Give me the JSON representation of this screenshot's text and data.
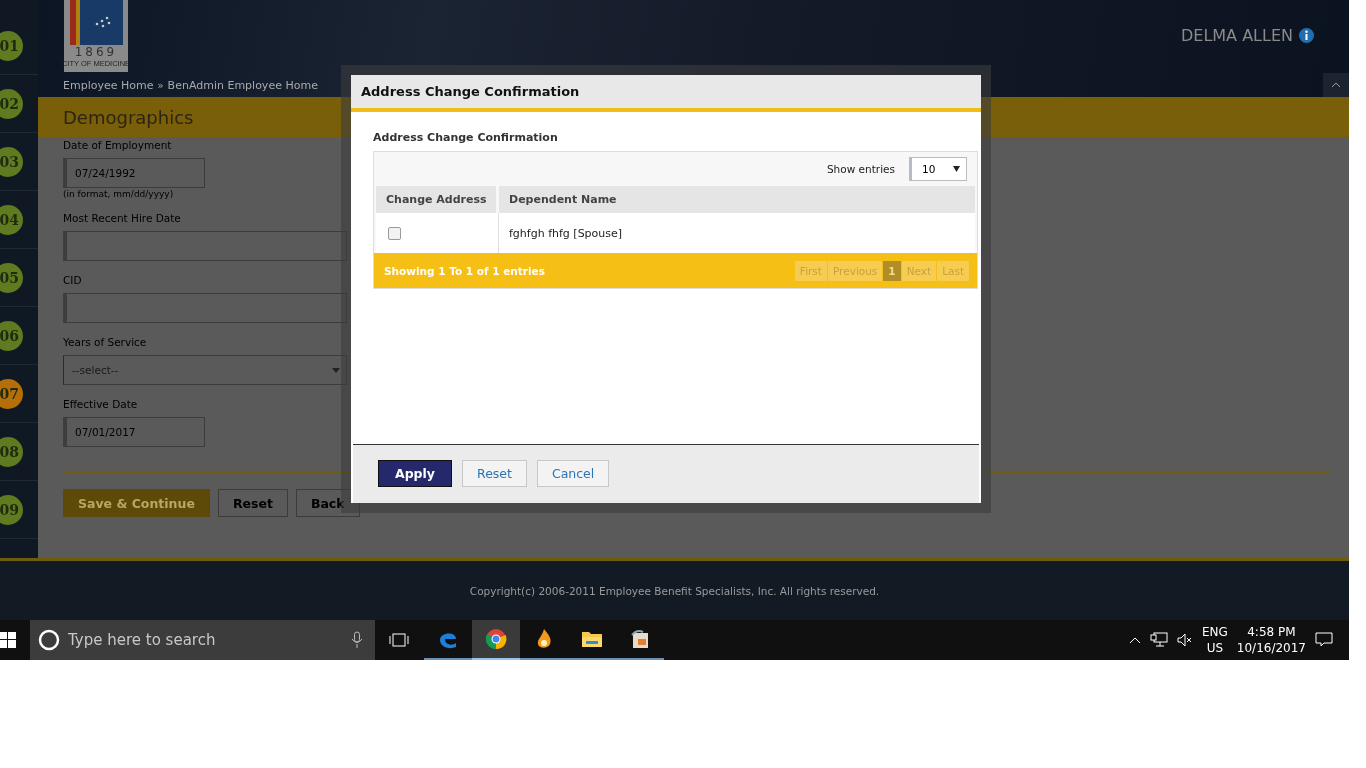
{
  "header": {
    "logo_year": "1869",
    "logo_caption": "CITY OF MEDICINE",
    "user_name": "DELMA ALLEN"
  },
  "breadcrumb": [
    {
      "label": "Employee Home"
    },
    {
      "label": "BenAdmin Employee Home"
    }
  ],
  "breadcrumb_separator": "»",
  "steps": [
    {
      "label": "01",
      "selected": false
    },
    {
      "label": "02",
      "selected": false
    },
    {
      "label": "03",
      "selected": false
    },
    {
      "label": "04",
      "selected": false
    },
    {
      "label": "05",
      "selected": false
    },
    {
      "label": "06",
      "selected": false
    },
    {
      "label": "07",
      "selected": true
    },
    {
      "label": "08",
      "selected": false
    },
    {
      "label": "09",
      "selected": false
    }
  ],
  "page_title": "Demographics",
  "form": [
    {
      "kind": "date",
      "label": "Date of Employment",
      "value": "07/24/1992",
      "hint": "(in format, mm/dd/yyyy)"
    },
    {
      "kind": "text",
      "label": "Most Recent Hire Date"
    },
    {
      "kind": "text",
      "label": "CID"
    },
    {
      "kind": "select",
      "label": "Years of Service",
      "placeholder": "--select--"
    },
    {
      "kind": "date",
      "label": "Effective Date",
      "value": "07/01/2017"
    }
  ],
  "form_buttons": [
    {
      "label": "Save & Continue",
      "kind": "primary"
    },
    {
      "label": "Reset",
      "kind": "secondary"
    },
    {
      "label": "Back",
      "kind": "secondary"
    }
  ],
  "footer": {
    "copyright": "Copyright(c) 2006-2011 Employee Benefit Specialists, Inc. All rights reserved."
  },
  "dialog": {
    "title": "Address Change Confirmation",
    "subtitle": "Address Change Confirmation",
    "show_entries_label": "Show entries",
    "page_size": "10",
    "columns": [
      "Change Address",
      "Dependent Name"
    ],
    "rows": [
      {
        "checked": false,
        "name": "fghfgh fhfg [Spouse]"
      }
    ],
    "info": "Showing 1 To 1 of 1 entries",
    "pager": [
      {
        "label": "First",
        "selected": false
      },
      {
        "label": "Previous",
        "selected": false
      },
      {
        "label": "1",
        "selected": true
      },
      {
        "label": "Next",
        "selected": false
      },
      {
        "label": "Last",
        "selected": false
      }
    ],
    "buttons": [
      {
        "label": "Apply",
        "kind": "primary"
      },
      {
        "label": "Reset",
        "kind": "secondary"
      },
      {
        "label": "Cancel",
        "kind": "secondary"
      }
    ]
  },
  "taskbar": {
    "search_placeholder": "Type here to search",
    "apps": [
      {
        "kind": "edge",
        "selected": false
      },
      {
        "kind": "chrome",
        "selected": true
      },
      {
        "kind": "flame",
        "selected": false
      },
      {
        "kind": "folder",
        "selected": false
      },
      {
        "kind": "installer",
        "selected": false
      }
    ],
    "language": "ENG",
    "region": "US",
    "time": "4:58 PM",
    "date": "10/16/2017"
  }
}
